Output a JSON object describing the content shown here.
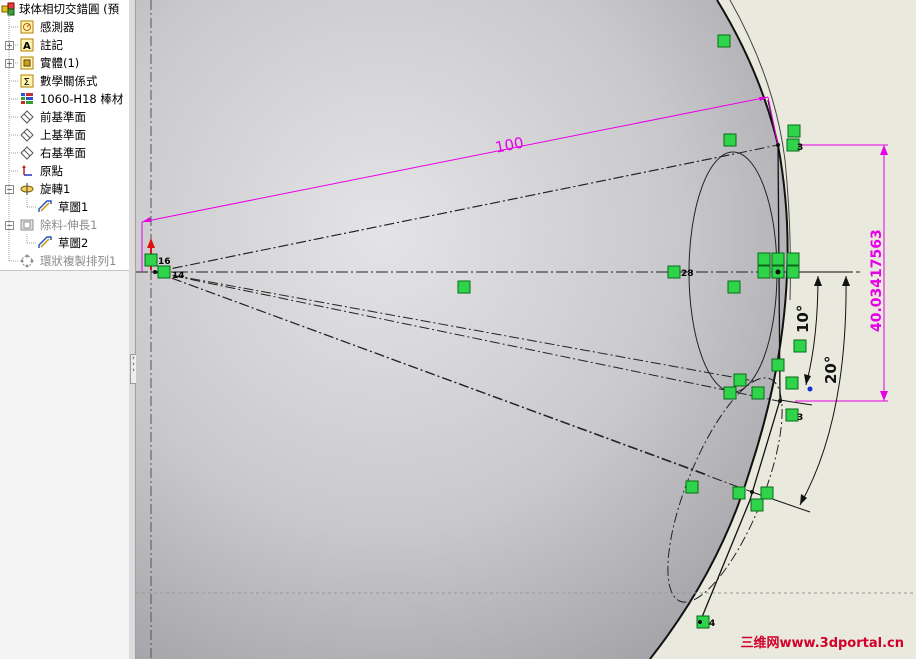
{
  "feature_tree": {
    "part_name": "球体相切交錯圓 (預",
    "items": [
      {
        "label": "感測器",
        "icon": "sensor-icon"
      },
      {
        "label": "註記",
        "icon": "annotation-icon"
      },
      {
        "label": "實體(1)",
        "icon": "solid-body-icon"
      },
      {
        "label": "數學關係式",
        "icon": "equation-icon"
      },
      {
        "label": "1060-H18 棒材",
        "icon": "material-icon"
      },
      {
        "label": "前基準面",
        "icon": "plane-icon"
      },
      {
        "label": "上基準面",
        "icon": "plane-icon"
      },
      {
        "label": "右基準面",
        "icon": "plane-icon"
      },
      {
        "label": "原點",
        "icon": "origin-icon"
      },
      {
        "label": "旋轉1",
        "icon": "revolve-icon"
      },
      {
        "label": "草圖1",
        "icon": "sketch-icon"
      },
      {
        "label": "除料-伸長1",
        "icon": "cut-extrude-icon"
      },
      {
        "label": "草圖2",
        "icon": "sketch-icon"
      },
      {
        "label": "環狀複製排列1",
        "icon": "circular-pattern-icon"
      }
    ]
  },
  "sketch": {
    "dimensions": {
      "length": "100",
      "height": "40.03417563",
      "angle_small": "10°",
      "angle_large": "20°"
    },
    "relation_numbers": {
      "n16": "16",
      "n14": "14",
      "n28": "28",
      "n3a": "3",
      "n3b": "3",
      "n4": "4"
    }
  },
  "watermark": "三维网www.3dportal.cn",
  "colors": {
    "dimension": "#e600e6",
    "relation_badge": "#2fd44a",
    "sketch_line": "#111111",
    "background": "#e9e9dd"
  }
}
